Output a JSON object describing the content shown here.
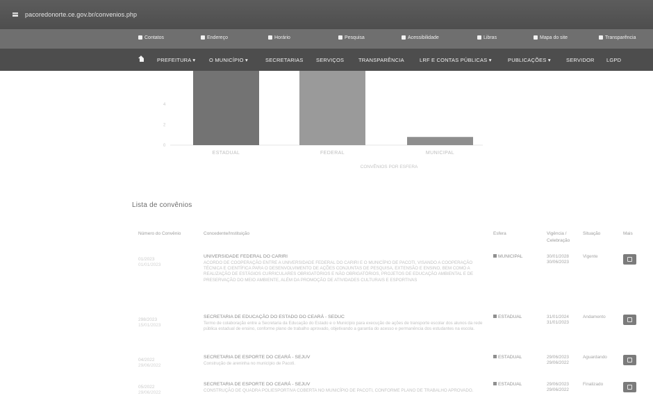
{
  "browser": {
    "url": "pacoredonorte.ce.gov.br/convenios.php"
  },
  "util_bar": {
    "items": [
      {
        "label": "Contatos",
        "icon": "phone-icon"
      },
      {
        "label": "Endereço",
        "icon": "location-icon"
      },
      {
        "label": "Horário",
        "icon": "clock-icon"
      },
      {
        "label": "Pesquisa",
        "icon": "search-icon"
      },
      {
        "label": "Acessibilidade",
        "icon": "accessibility-icon"
      },
      {
        "label": "Libras",
        "icon": "libras-icon"
      },
      {
        "label": "Mapa do site",
        "icon": "sitemap-icon"
      },
      {
        "label": "Transparência",
        "icon": "transparency-icon"
      }
    ]
  },
  "nav": {
    "items": [
      "PREFEITURA ▾",
      "O MUNICÍPIO ▾",
      "SECRETARIAS",
      "SERVIÇOS",
      "TRANSPARÊNCIA",
      "LRF E CONTAS PÚBLICAS ▾",
      "PUBLICAÇÕES ▾",
      "SERVIDOR",
      "LGPD"
    ]
  },
  "chart_data": {
    "type": "bar",
    "categories": [
      "ESTADUAL",
      "FEDERAL",
      "MUNICIPAL"
    ],
    "values": [
      9,
      8,
      0.8
    ],
    "xlabel": "CONVÊNIOS POR ESFERA",
    "ylim": [
      0,
      10
    ],
    "yticks": [
      0,
      2,
      4
    ],
    "grid": false,
    "colors": [
      "#737373",
      "#9a9a9a",
      "#8e8e8e"
    ]
  },
  "list": {
    "title": "Lista de convênios",
    "headers": {
      "numero": "Número do Convênio",
      "concedente": "Concedente/Instituição",
      "esfera": "Esfera",
      "vigencia": "Vigência / Celebração",
      "situacao": "Situação",
      "mais": "Mais"
    },
    "rows": [
      {
        "numero": "01/2023",
        "numero_sub": "01/01/2023",
        "title": "UNIVERSIDADE FEDERAL DO CARIRI",
        "desc": "ACORDO DE COOPERAÇÃO ENTRE A UNIVERSIDADE FEDERAL DO CARIRI E O MUNICÍPIO DE PACOTI, VISANDO A COOPERAÇÃO TÉCNICA E CIENTÍFICA PARA O DESENVOLVIMENTO DE AÇÕES CONJUNTAS DE PESQUISA, EXTENSÃO E ENSINO, BEM COMO A REALIZAÇÃO DE ESTÁGIOS CURRICULARES OBRIGATÓRIOS E NÃO OBRIGATÓRIOS, PROJETOS DE EDUCAÇÃO AMBIENTAL E DE PRESERVAÇÃO DO MEIO AMBIENTE, ALÉM DA PROMOÇÃO DE ATIVIDADES CULTURAIS E ESPORTIVAS",
        "esfera": "MUNICIPAL",
        "vigencia": "30/01/2028",
        "celebracao": "30/06/2023",
        "situacao": "Vigente"
      },
      {
        "numero": "298/2023",
        "numero_sub": "15/01/2023",
        "title": "SECRETARIA DE EDUCAÇÃO DO ESTADO DO CEARÁ - SEDUC",
        "desc": "Termo de colaboração entre a Secretaria da Educação do Estado e o Município para execução de ações de transporte escolar dos alunos da rede pública estadual de ensino, conforme plano de trabalho aprovado, objetivando a garantia do acesso e permanência dos estudantes na escola.",
        "esfera": "ESTADUAL",
        "vigencia": "31/01/2024",
        "celebracao": "31/01/2023",
        "situacao": "Andamento"
      },
      {
        "numero": "04/2022",
        "numero_sub": "29/06/2022",
        "title": "SECRETARIA DE ESPORTE DO CEARÁ - SEJUV",
        "desc": "Construção de areninha no município de Pacoti.",
        "esfera": "ESTADUAL",
        "vigencia": "29/06/2023",
        "celebracao": "29/06/2022",
        "situacao": "Aguardando"
      },
      {
        "numero": "05/2022",
        "numero_sub": "29/06/2022",
        "title": "SECRETARIA DE ESPORTE DO CEARÁ - SEJUV",
        "desc": "CONSTRUÇÃO DE QUADRA POLIESPORTIVA COBERTA NO MUNICÍPIO DE PACOTI, CONFORME PLANO DE TRABALHO APROVADO.",
        "esfera": "ESTADUAL",
        "vigencia": "29/06/2023",
        "celebracao": "29/06/2022",
        "situacao": "Finalizado"
      }
    ]
  }
}
